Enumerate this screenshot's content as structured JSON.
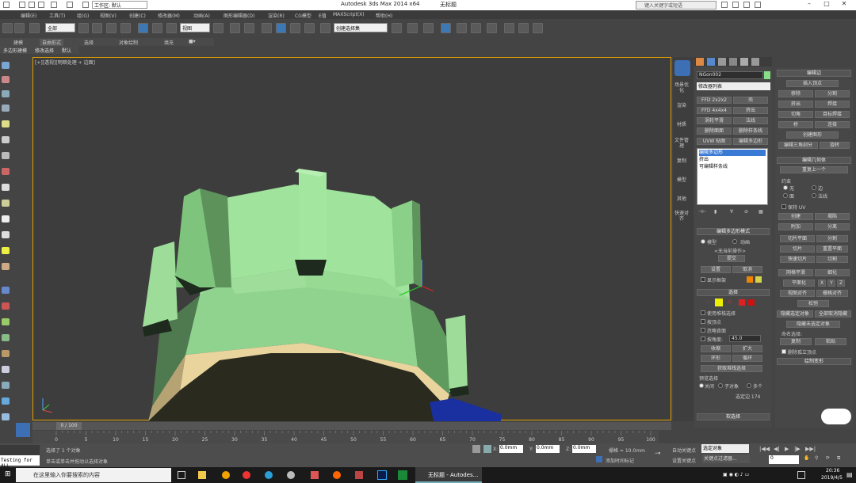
{
  "window": {
    "title": "Autodesk 3ds Max  2014 x64",
    "doc": "无标题",
    "workspace": "工作区: 默认",
    "search_placeholder": "键入关键字或短语"
  },
  "menu": [
    "编辑(E)",
    "工具(T)",
    "组(G)",
    "视图(V)",
    "创建(C)",
    "修改器(M)",
    "动画(A)",
    "图形编辑器(D)",
    "渲染(R)",
    "CG模型",
    "E值",
    "MAXScript(X)",
    "帮助(H)"
  ],
  "toolbar": {
    "select_filter": "全部",
    "view_dropdown": "视图",
    "named_selection": "创建选择集"
  },
  "ribbon": {
    "tabs": [
      "建模",
      "自由形式",
      "选择",
      "对象绘制",
      "填充"
    ],
    "subtabs": [
      "多边形建模",
      "修改选择",
      "默认"
    ]
  },
  "viewport": {
    "label": "[+][透视][明暗处理 + 边面]"
  },
  "cmd_tabs": [
    "场景优化",
    "渲染",
    "材质",
    "文件管理",
    "复制",
    "模型",
    "其他",
    "快速对齐"
  ],
  "modify": {
    "object_name": "NGon002",
    "modifier_list": "修改器列表",
    "color": "#88dd88",
    "mod_buttons": [
      "FFD 2x2x2",
      "壳",
      "FFD 4x4x4",
      "挤出",
      "涡轮平滑",
      "法线",
      "删除面面",
      "删除样条线",
      "UVW 贴图",
      "编辑多边形"
    ],
    "stack": [
      "编辑多边形",
      "挤出",
      "可编辑样条线"
    ]
  },
  "edit_poly_mode": {
    "title": "编辑多边形模式",
    "model": "模型",
    "anim": "动画",
    "no_op": "<无当前操作>",
    "commit": "提交",
    "settings": "设置",
    "cancel": "取消",
    "show_cage": "显示框架"
  },
  "selection": {
    "title": "选择",
    "by_vertex": "使用堆栈选择",
    "by_vertex2": "按顶点",
    "ignore_back": "忽略背面",
    "by_angle": "按角度:",
    "angle": "45.0",
    "shrink": "收缩",
    "grow": "扩大",
    "ring": "环形",
    "loop": "循环",
    "get_stack": "获取堆栈选择",
    "preview": "预览选择",
    "off": "关闭",
    "subobj": "子对象",
    "multi": "多个",
    "sel_edges": "选定边 174",
    "soft": "软选择"
  },
  "edit_edges": {
    "title": "编辑边",
    "insert_vertex": "插入顶点",
    "remove": "移除",
    "split": "分割",
    "extrude": "挤出",
    "weld": "焊接",
    "chamfer": "切角",
    "target_weld": "目标焊接",
    "bridge": "桥",
    "connect": "连接",
    "create_shape": "创建图形",
    "edit_tri": "编辑三角剖分",
    "rotate": "旋转"
  },
  "edit_geo": {
    "title": "编辑几何体",
    "repeat": "重复上一个",
    "constraints": "约束",
    "none": "无",
    "edge": "边",
    "face": "面",
    "normal": "法线",
    "preserve_uv": "保持 UV",
    "create": "创建",
    "collapse": "塌陷",
    "attach": "附加",
    "detach": "分离",
    "slice_plane": "切片平面",
    "split": "分割",
    "slice": "切片",
    "reset_plane": "重置平面",
    "quickslice": "快速切片",
    "cut": "切割",
    "meshsmooth": "网格平滑",
    "tessellate": "细化",
    "planarize": "平面化",
    "x": "X",
    "y": "Y",
    "z": "Z",
    "view_align": "视图对齐",
    "grid_align": "栅格对齐",
    "relax": "松弛",
    "hide_sel": "隐藏选定对象",
    "unhide_all": "全部取消隐藏",
    "hide_unsel": "隐藏未选定对象",
    "named_sel": "命名选择:",
    "copy": "复制",
    "paste": "粘贴",
    "del_iso": "删除孤立顶点",
    "paint": "绘制变形"
  },
  "time": {
    "frame": "0 / 100",
    "ticks": [
      "0",
      "5",
      "10",
      "15",
      "20",
      "25",
      "30",
      "35",
      "40",
      "45",
      "50",
      "55",
      "60",
      "65",
      "70",
      "75",
      "80",
      "85",
      "90",
      "95",
      "100"
    ]
  },
  "status": {
    "selected": "选择了 1 个对象",
    "hint": "单击或单击并拖动以选择对象",
    "maxscript": "Testing for ALL",
    "x": "0.0mm",
    "y": "0.0mm",
    "z": "0.0mm",
    "grid": "栅格 = 10.0mm",
    "add_time": "添加时间标记",
    "autokey": "自动关键点",
    "sel_set": "选定对象",
    "set_key": "设置关键点",
    "key_filter": "关键点过滤器...",
    "frame_field": "0"
  },
  "taskbar": {
    "search": "在这里输入你要搜索的内容",
    "app": "无标题 - Autodes...",
    "time": "20:36",
    "date": "2019/4/5"
  }
}
